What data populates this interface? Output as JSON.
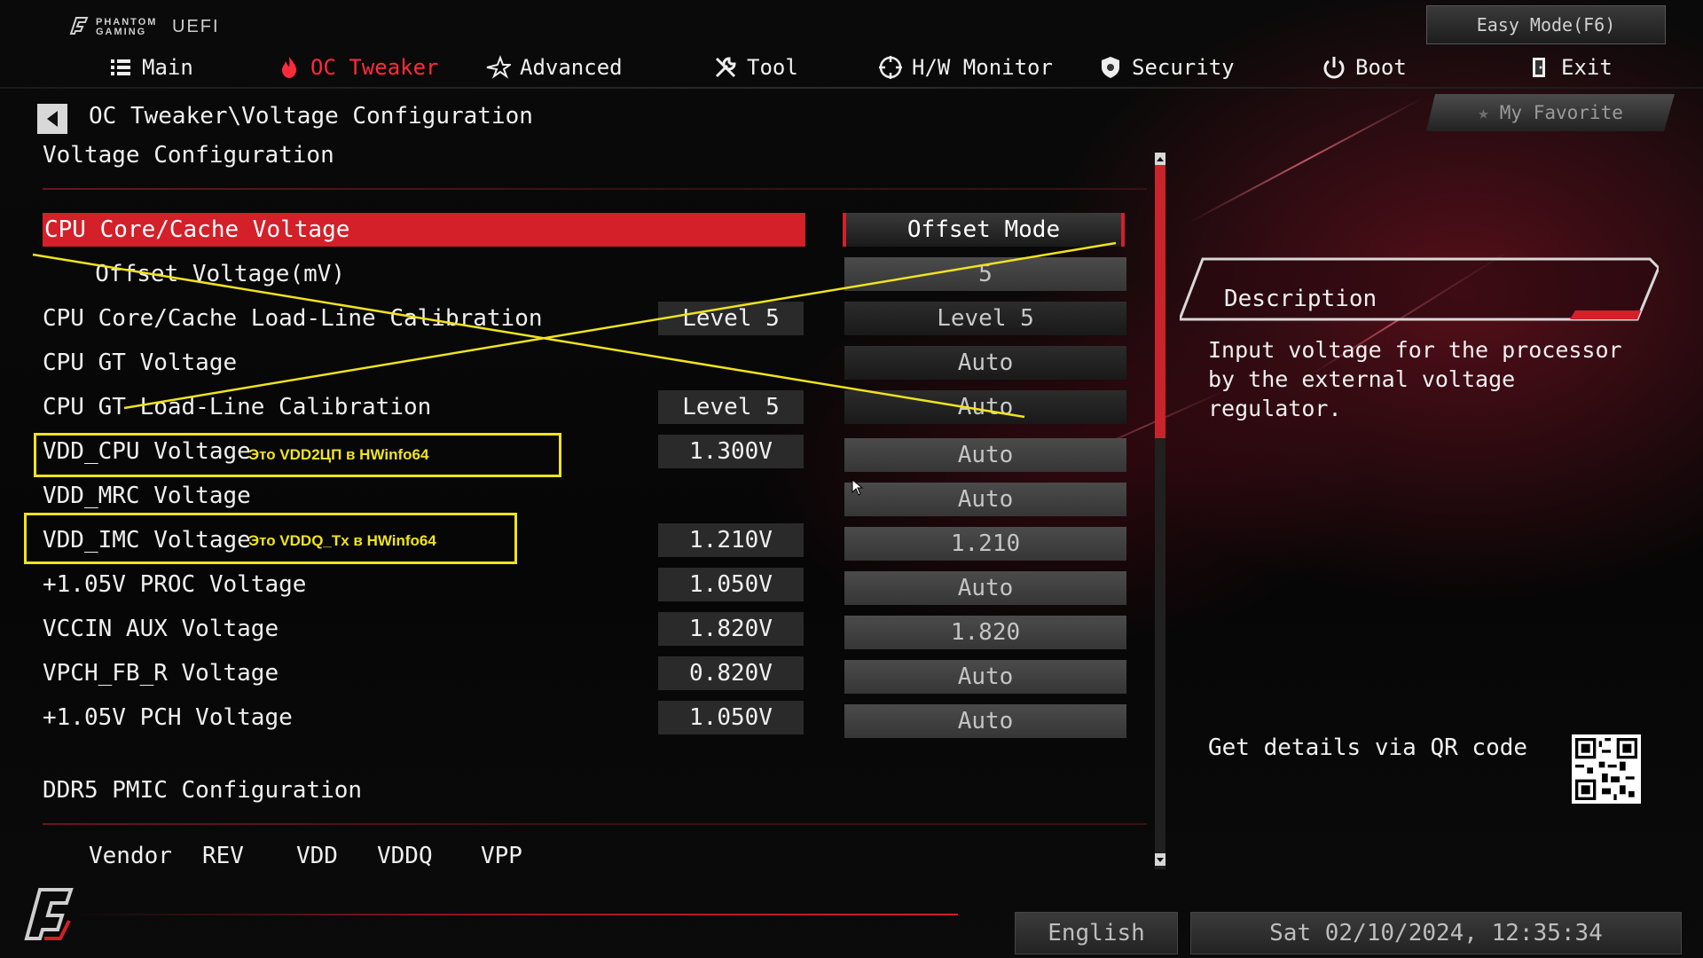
{
  "header": {
    "brand_small": "PHANTOM GAMING",
    "brand_uefi": "UEFI",
    "easy_mode": "Easy Mode(F6)",
    "my_favorite": "My Favorite"
  },
  "nav": [
    {
      "label": "Main",
      "icon": "list-icon",
      "active": false
    },
    {
      "label": "OC Tweaker",
      "icon": "flame-icon",
      "active": true
    },
    {
      "label": "Advanced",
      "icon": "star-icon",
      "active": false
    },
    {
      "label": "Tool",
      "icon": "wrench-icon",
      "active": false
    },
    {
      "label": "H/W Monitor",
      "icon": "crosshair-icon",
      "active": false
    },
    {
      "label": "Security",
      "icon": "shield-icon",
      "active": false
    },
    {
      "label": "Boot",
      "icon": "power-icon",
      "active": false
    },
    {
      "label": "Exit",
      "icon": "exit-door-icon",
      "active": false
    }
  ],
  "breadcrumb": "OC Tweaker\\Voltage Configuration",
  "section_title": "Voltage Configuration",
  "rows": [
    {
      "label": "CPU Core/Cache Voltage",
      "current": "",
      "value": "Offset Mode",
      "selected": true
    },
    {
      "label": "  Offset Voltage(mV)",
      "current": "",
      "value": "5"
    },
    {
      "label": "CPU Core/Cache Load-Line Calibration",
      "current": "Level 5",
      "value": "Level 5"
    },
    {
      "label": "CPU GT Voltage",
      "current": "",
      "value": "Auto"
    },
    {
      "label": "CPU GT Load-Line Calibration",
      "current": "Level 5",
      "value": "Auto"
    },
    {
      "label": "VDD_CPU Voltage",
      "current": "1.300V",
      "value": "Auto"
    },
    {
      "label": "VDD_MRC Voltage",
      "current": "",
      "value": "Auto"
    },
    {
      "label": "VDD_IMC Voltage",
      "current": "1.210V",
      "value": "1.210"
    },
    {
      "label": "+1.05V PROC Voltage",
      "current": "1.050V",
      "value": "Auto"
    },
    {
      "label": "VCCIN AUX Voltage",
      "current": "1.820V",
      "value": "1.820"
    },
    {
      "label": "VPCH_FB_R Voltage",
      "current": "0.820V",
      "value": "Auto"
    },
    {
      "label": "+1.05V PCH Voltage",
      "current": "1.050V",
      "value": "Auto"
    }
  ],
  "annotations": {
    "vdd_cpu": "Это VDD2ЦП в HWinfo64",
    "vdd_imc": "Это VDDQ_Tx в HWinfo64"
  },
  "pmic": {
    "title": "DDR5 PMIC Configuration",
    "columns": [
      "Vendor",
      "REV",
      "VDD",
      "VDDQ",
      "VPP"
    ]
  },
  "description": {
    "title": "Description",
    "text": "Input voltage for the processor by the external voltage regulator.",
    "qr_label": "Get details via QR code"
  },
  "footer": {
    "language": "English",
    "datetime": "Sat 02/10/2024, 12:35:34"
  },
  "colors": {
    "accent_red": "#d32029",
    "annotation_yellow": "#f0e31e"
  }
}
